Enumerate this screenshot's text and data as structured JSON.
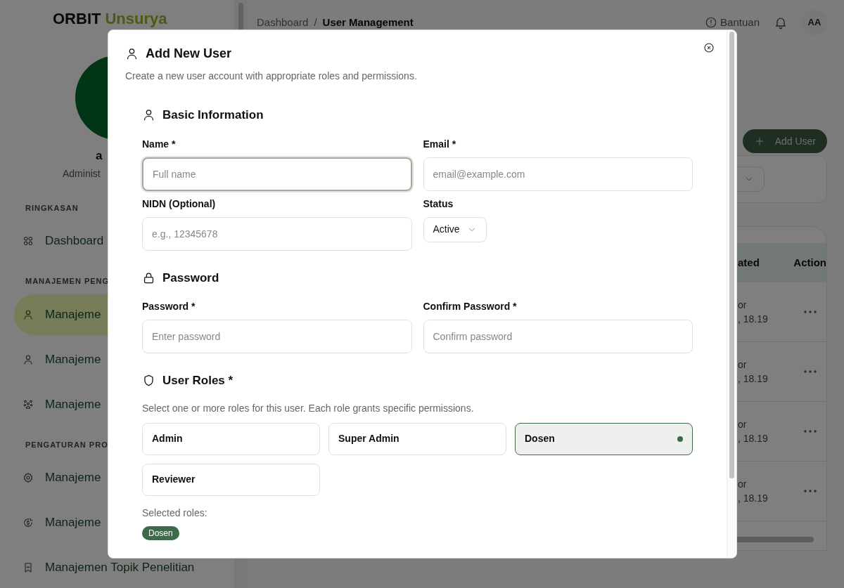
{
  "sidebar": {
    "brand": [
      "ORBIT",
      "Unsurya"
    ],
    "user_name": "a",
    "user_role": "Administ",
    "sections": [
      {
        "title": "RINGKASAN",
        "items": [
          {
            "label": "Dashboard",
            "selected": false
          }
        ]
      },
      {
        "title": "MANAJEMEN PENG",
        "items": [
          {
            "label": "Manajeme",
            "selected": true
          },
          {
            "label": "Manajeme",
            "selected": false
          },
          {
            "label": "Manajeme",
            "selected": false
          }
        ]
      },
      {
        "title": "PENGATURAN PRO",
        "items": [
          {
            "label": "Manajeme",
            "selected": false
          },
          {
            "label": "Manajeme",
            "selected": false
          },
          {
            "label": "Manajemen Topik Penelitian",
            "selected": false
          }
        ]
      }
    ]
  },
  "header": {
    "breadcrumb": [
      "Dashboard",
      "User Management"
    ],
    "breadcrumb_separator": "/",
    "help": "Bantuan",
    "avatar": "AA"
  },
  "main": {
    "add_button": "Add User",
    "table": {
      "columns": [
        "ated",
        "Action"
      ],
      "rows": [
        {
          "cells": [
            "or",
            ", 18.19"
          ]
        },
        {
          "cells": [
            "or",
            ", 18.19"
          ]
        },
        {
          "cells": [
            "or",
            ", 18.19"
          ]
        },
        {
          "cells": [
            "or",
            ", 18.19"
          ]
        }
      ]
    }
  },
  "dialog": {
    "title": "Add New User",
    "subtitle": "Create a new user account with appropriate roles and permissions.",
    "sections": [
      {
        "kind": "fields",
        "title": "Basic Information",
        "fields": [
          {
            "kind": "input",
            "label": "Name *",
            "placeholder": "Full name",
            "focused": true
          },
          {
            "kind": "input",
            "label": "Email *",
            "placeholder": "email@example.com",
            "focused": false
          },
          {
            "kind": "input",
            "label": "NIDN (Optional)",
            "placeholder": "e.g., 12345678",
            "focused": false
          },
          {
            "kind": "select",
            "label": "Status",
            "value": "Active"
          }
        ]
      },
      {
        "kind": "fields",
        "title": "Password",
        "fields": [
          {
            "kind": "input",
            "label": "Password *",
            "placeholder": "Enter password",
            "focused": false
          },
          {
            "kind": "input",
            "label": "Confirm Password *",
            "placeholder": "Confirm password",
            "focused": false
          }
        ]
      },
      {
        "kind": "roles",
        "title": "User Roles *",
        "hint": "Select one or more roles for this user. Each role grants specific permissions.",
        "roles": [
          {
            "label": "Admin",
            "selected": false
          },
          {
            "label": "Super Admin",
            "selected": false
          },
          {
            "label": "Dosen",
            "selected": true
          },
          {
            "label": "Reviewer",
            "selected": false
          }
        ],
        "selected_label": "Selected roles:",
        "selected_tags": [
          "Dosen"
        ]
      }
    ]
  }
}
